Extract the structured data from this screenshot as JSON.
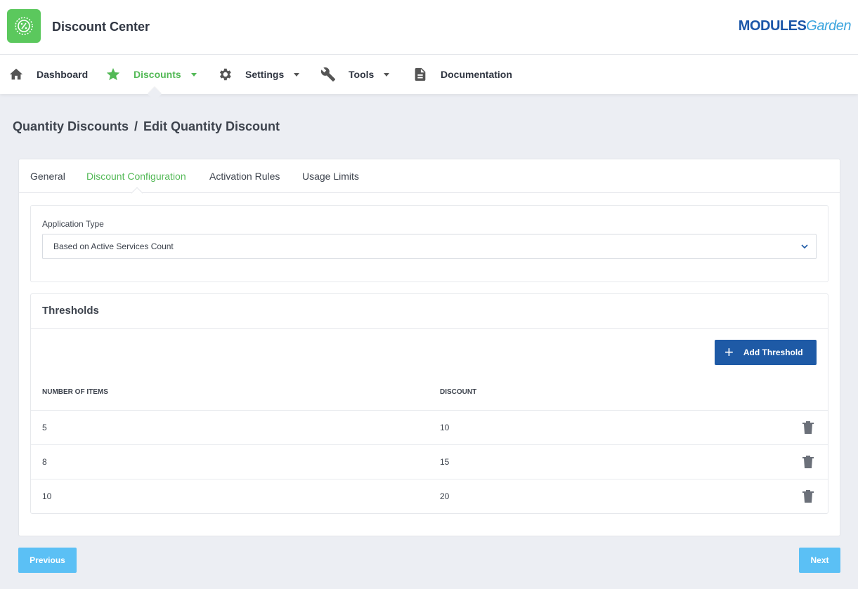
{
  "header": {
    "title": "Discount Center",
    "brand_modules": "MODULES",
    "brand_garden": "Garden"
  },
  "nav": {
    "items": [
      {
        "label": "Dashboard",
        "icon": "home-icon"
      },
      {
        "label": "Discounts",
        "icon": "star-icon",
        "active": true
      },
      {
        "label": "Settings",
        "icon": "gear-icon"
      },
      {
        "label": "Tools",
        "icon": "wrench-icon"
      },
      {
        "label": "Documentation",
        "icon": "document-icon"
      }
    ]
  },
  "breadcrumb": {
    "parent": "Quantity Discounts",
    "separator": "/",
    "current": "Edit Quantity Discount"
  },
  "tabs": [
    {
      "label": "General"
    },
    {
      "label": "Discount Configuration",
      "active": true
    },
    {
      "label": "Activation Rules"
    },
    {
      "label": "Usage Limits"
    }
  ],
  "application": {
    "label": "Application Type",
    "value": "Based on Active Services Count"
  },
  "thresholds": {
    "title": "Thresholds",
    "add_label": "Add Threshold",
    "col_items": "NUMBER OF ITEMS",
    "col_discount": "DISCOUNT",
    "rows": [
      {
        "items": "5",
        "discount": "10"
      },
      {
        "items": "8",
        "discount": "15"
      },
      {
        "items": "10",
        "discount": "20"
      }
    ]
  },
  "footer": {
    "previous_label": "Previous",
    "next_label": "Next"
  },
  "colors": {
    "accent_green": "#53b956",
    "primary_blue": "#1e5aa6",
    "light_blue": "#5bc0f5"
  }
}
